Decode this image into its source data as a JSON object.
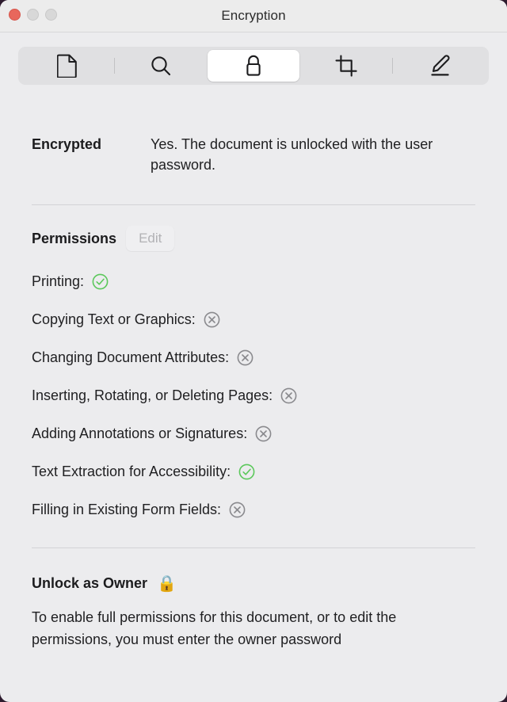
{
  "window": {
    "title": "Encryption",
    "traffic_lights": [
      {
        "name": "close",
        "color": "#e8675c"
      },
      {
        "name": "minimize",
        "color": "#d8d8d8"
      },
      {
        "name": "maximize",
        "color": "#d8d8d8"
      }
    ]
  },
  "toolbar": {
    "segments": [
      {
        "icon": "document-icon",
        "label": "Document",
        "selected": false
      },
      {
        "icon": "search-icon",
        "label": "Search",
        "selected": false
      },
      {
        "icon": "lock-icon",
        "label": "Encryption",
        "selected": true
      },
      {
        "icon": "crop-icon",
        "label": "Crop",
        "selected": false
      },
      {
        "icon": "pencil-icon",
        "label": "Markup",
        "selected": false
      }
    ]
  },
  "encrypted": {
    "label": "Encrypted",
    "value": "Yes. The document is unlocked with the user password."
  },
  "permissions": {
    "title": "Permissions",
    "edit_label": "Edit",
    "edit_disabled": true,
    "items": [
      {
        "label": "Printing:",
        "status": "allowed"
      },
      {
        "label": "Copying Text or Graphics:",
        "status": "denied"
      },
      {
        "label": "Changing Document Attributes:",
        "status": "denied"
      },
      {
        "label": "Inserting, Rotating, or Deleting Pages:",
        "status": "denied"
      },
      {
        "label": "Adding Annotations or Signatures:",
        "status": "denied"
      },
      {
        "label": "Text Extraction for Accessibility:",
        "status": "allowed"
      },
      {
        "label": "Filling in Existing Form Fields:",
        "status": "denied"
      }
    ]
  },
  "unlock": {
    "title": "Unlock as Owner",
    "icon": "padlock-emoji",
    "icon_glyph": "🔒",
    "body": "To enable full permissions for this document, or to edit the permissions, you must enter the owner password"
  },
  "colors": {
    "allowed": "#5bc85b",
    "denied": "#8a8a8e",
    "window_bg": "#ececee",
    "titlebar_bg": "#ececec",
    "segment_bg": "#e0e0e2",
    "selected_bg": "#ffffff"
  }
}
